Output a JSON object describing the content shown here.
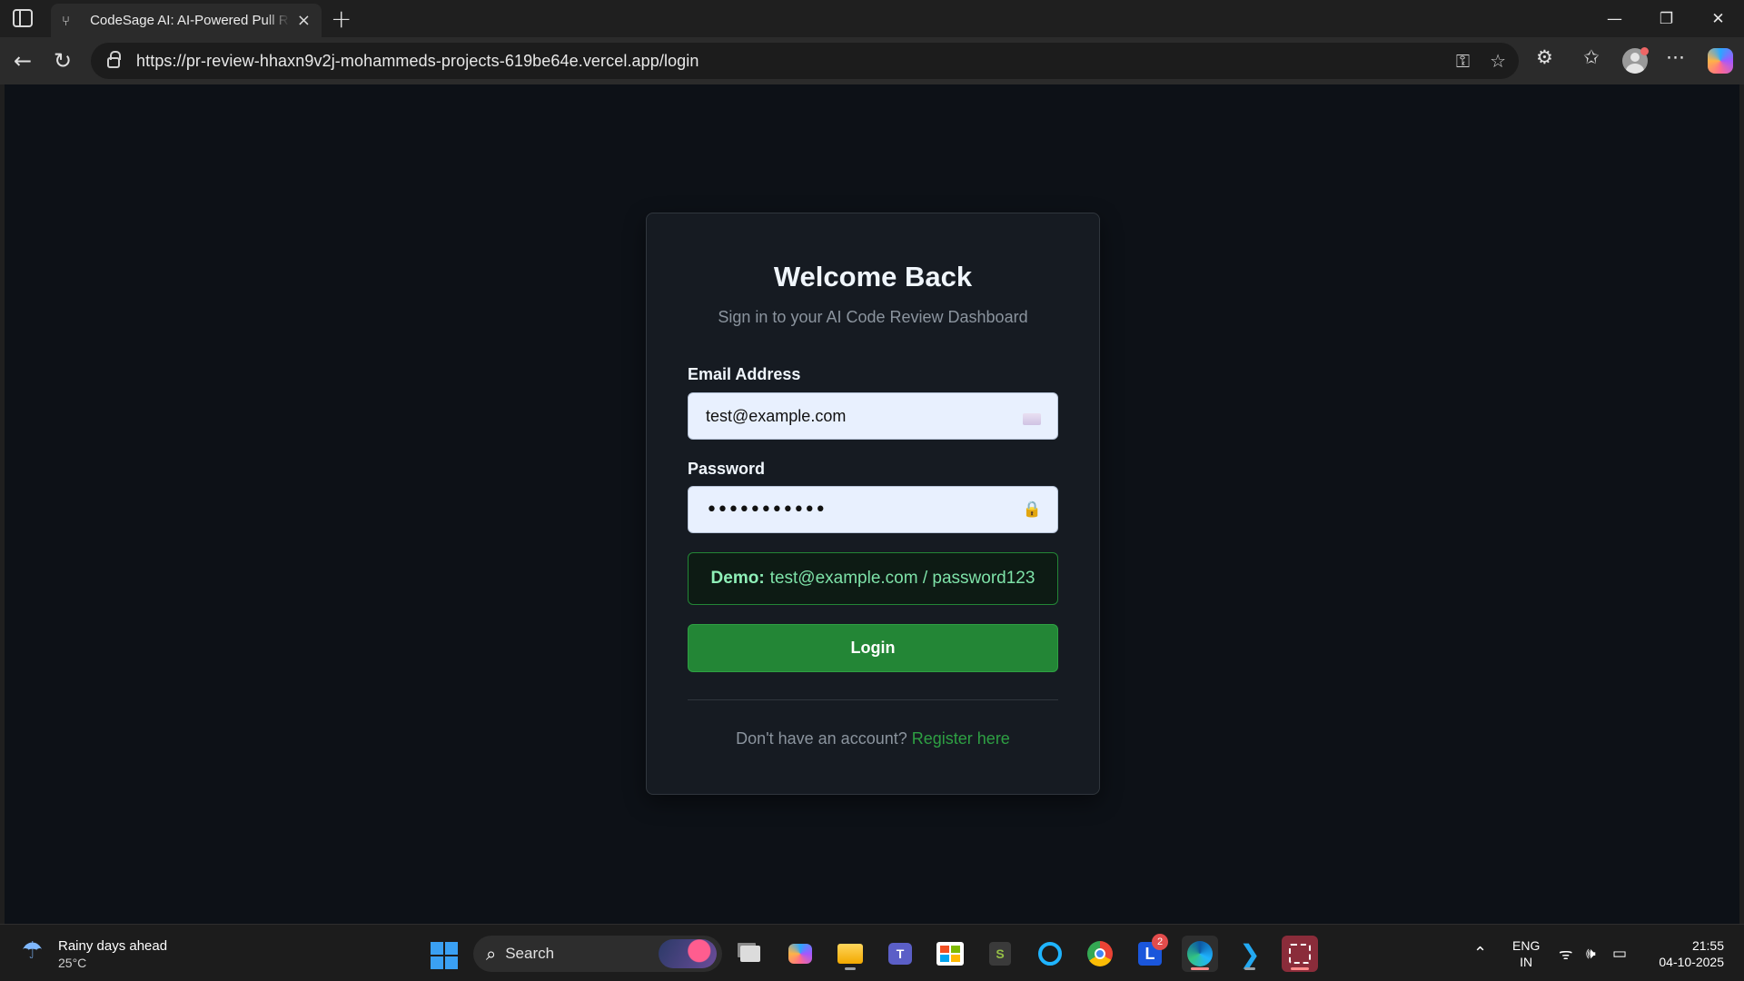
{
  "browser": {
    "tab_title": "CodeSage AI: AI-Powered Pull Request Review",
    "tab_close": "×",
    "new_tab": "+",
    "url": "https://pr-review-hhaxn9v2j-mohammeds-projects-619be64e.vercel.app/login",
    "window_controls": {
      "minimize": "—",
      "restore": "❐",
      "close": "✕"
    },
    "nav": {
      "back": "←",
      "reload": "↻"
    },
    "icons": [
      "sidebar-toggle-icon",
      "key-icon",
      "star-icon",
      "extensions-icon",
      "favorites-icon",
      "profile-avatar",
      "more-icon",
      "copilot-icon"
    ]
  },
  "login": {
    "title": "Welcome Back",
    "subtitle": "Sign in to your AI Code Review Dashboard",
    "email_label": "Email Address",
    "email_value": "test@example.com",
    "password_label": "Password",
    "password_value": "•••••••••••",
    "demo_prefix": "Demo:",
    "demo_text": "test@example.com / password123",
    "login_button": "Login",
    "register_prompt": "Don't have an account?",
    "register_link": "Register here"
  },
  "taskbar": {
    "weather_title": "Rainy days ahead",
    "weather_temp": "25°C",
    "search_label": "Search",
    "badge_count": "2",
    "lang_line1": "ENG",
    "lang_line2": "IN",
    "time": "21:55",
    "date": "04-10-2025",
    "apps": [
      "task-view",
      "copilot",
      "file-explorer",
      "teams",
      "microsoft-store",
      "shopify",
      "cortana",
      "chrome",
      "l-app",
      "edge",
      "vscode",
      "snipping-tool"
    ]
  },
  "colors": {
    "page_bg": "#0d1117",
    "card_bg": "#161b22",
    "accent_green": "#238636",
    "link_green": "#2ea043",
    "input_bg": "#e8f0fe"
  }
}
